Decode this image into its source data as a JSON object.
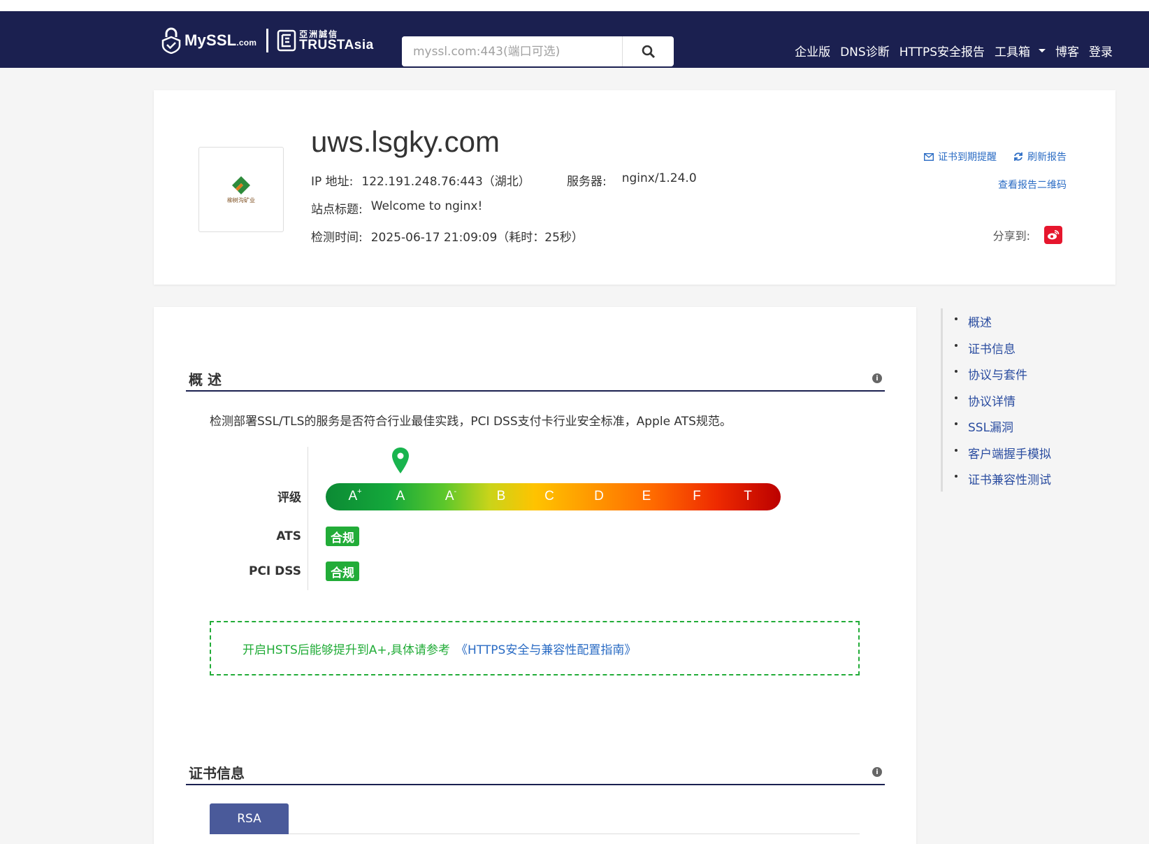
{
  "header": {
    "logo_myssl": "MySSL",
    "logo_myssl_suffix": ".com",
    "logo_ta_cn": "亞洲誠信",
    "logo_ta_en": "TRUSTAsia",
    "search_placeholder": "myssl.com:443(端口可选)",
    "nav": [
      {
        "label": "企业版"
      },
      {
        "label": "DNS诊断"
      },
      {
        "label": "HTTPS安全报告"
      },
      {
        "label": "工具箱"
      },
      {
        "label": "博客"
      },
      {
        "label": "登录"
      }
    ]
  },
  "site": {
    "domain": "uws.lsgky.com",
    "logo_caption": "柳树沟矿业",
    "ip_label": "IP 地址:",
    "ip_value": "122.191.248.76:443（湖北）",
    "server_label": "服务器:",
    "server_value": "nginx/1.24.0",
    "title_label": "站点标题:",
    "title_value": "Welcome to nginx!",
    "time_label": "检测时间:",
    "time_value": "2025-06-17 21:09:09（耗时：25秒）"
  },
  "actions": {
    "cert_reminder": "证书到期提醒",
    "refresh": "刷新报告",
    "qr": "查看报告二维码",
    "share": "分享到:"
  },
  "overview": {
    "title": "概 述",
    "description": "检测部署SSL/TLS的服务是否符合行业最佳实践，PCI DSS支付卡行业安全标准，Apple ATS规范。",
    "rating_label": "评级",
    "ats_label": "ATS",
    "pci_label": "PCI DSS",
    "ats_status": "合规",
    "pci_status": "合规",
    "grades": [
      "A",
      "A",
      "A",
      "B",
      "C",
      "D",
      "E",
      "F",
      "T"
    ],
    "grade_marks": [
      "+",
      "",
      "-",
      "",
      "",
      "",
      "",
      "",
      ""
    ],
    "current_grade": "A",
    "hint_text": "开启HSTS后能够提升到A+,具体请参考",
    "hint_link": "《HTTPS安全与兼容性配置指南》"
  },
  "cert": {
    "title": "证书信息",
    "tabs": [
      "RSA"
    ]
  },
  "sidebar": {
    "items": [
      {
        "label": "概述"
      },
      {
        "label": "证书信息"
      },
      {
        "label": "协议与套件"
      },
      {
        "label": "协议详情"
      },
      {
        "label": "SSL漏洞"
      },
      {
        "label": "客户端握手模拟"
      },
      {
        "label": "证书兼容性测试"
      }
    ]
  },
  "colors": {
    "navbar": "#1b2050",
    "link": "#2b6cc4",
    "success": "#22ac38"
  }
}
